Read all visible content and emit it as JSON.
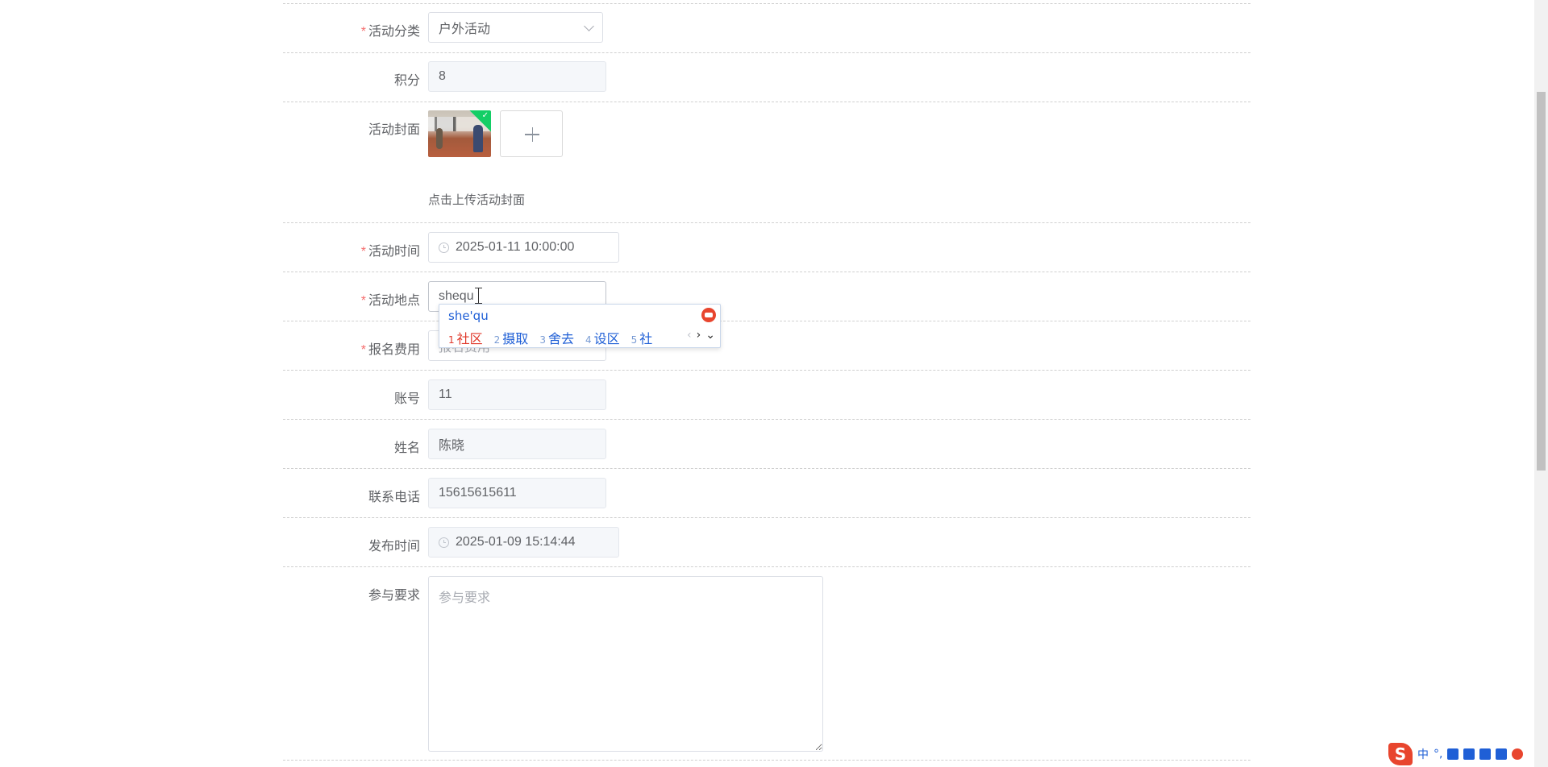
{
  "form": {
    "category": {
      "label": "活动分类",
      "required": true,
      "value": "户外活动"
    },
    "points": {
      "label": "积分",
      "required": false,
      "value": "8"
    },
    "cover": {
      "label": "活动封面",
      "required": false,
      "tip": "点击上传活动封面"
    },
    "activity_time": {
      "label": "活动时间",
      "required": true,
      "value": "2025-01-11 10:00:00"
    },
    "location": {
      "label": "活动地点",
      "required": true,
      "value": "shequ"
    },
    "fee": {
      "label": "报名费用",
      "required": true,
      "placeholder": "报名费用"
    },
    "account": {
      "label": "账号",
      "required": false,
      "value": "11"
    },
    "name": {
      "label": "姓名",
      "required": false,
      "value": "陈晓"
    },
    "phone": {
      "label": "联系电话",
      "required": false,
      "value": "15615615611"
    },
    "publish_time": {
      "label": "发布时间",
      "required": false,
      "value": "2025-01-09 15:14:44"
    },
    "requirements": {
      "label": "参与要求",
      "required": false,
      "placeholder": "参与要求"
    }
  },
  "ime": {
    "composition": "she'qu",
    "candidates": [
      {
        "num": "1",
        "word": "社区"
      },
      {
        "num": "2",
        "word": "摄取"
      },
      {
        "num": "3",
        "word": "舍去"
      },
      {
        "num": "4",
        "word": "设区"
      },
      {
        "num": "5",
        "word": "社"
      }
    ],
    "nav_prev": "‹",
    "nav_next": "›",
    "nav_expand": "⌄"
  },
  "tray": {
    "logo": "S",
    "mode": "中",
    "punct": "°,"
  }
}
